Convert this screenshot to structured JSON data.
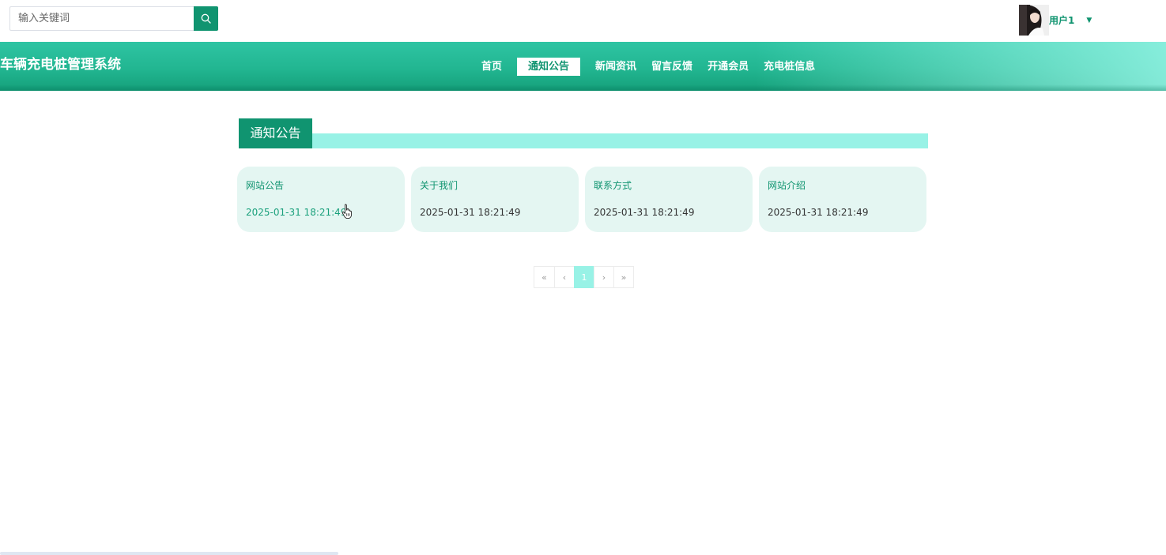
{
  "search": {
    "placeholder": "输入关键词"
  },
  "user": {
    "name": "用户1"
  },
  "header": {
    "title": "车辆充电桩管理系统",
    "nav": [
      {
        "label": "首页",
        "active": false
      },
      {
        "label": "通知公告",
        "active": true
      },
      {
        "label": "新闻资讯",
        "active": false
      },
      {
        "label": "留言反馈",
        "active": false
      },
      {
        "label": "开通会员",
        "active": false
      },
      {
        "label": "充电桩信息",
        "active": false
      }
    ]
  },
  "section": {
    "title": "通知公告"
  },
  "cards": [
    {
      "title": "网站公告",
      "time": "2025-01-31 18:21:49"
    },
    {
      "title": "关于我们",
      "time": "2025-01-31 18:21:49"
    },
    {
      "title": "联系方式",
      "time": "2025-01-31 18:21:49"
    },
    {
      "title": "网站介绍",
      "time": "2025-01-31 18:21:49"
    }
  ],
  "pagination": {
    "first": "«",
    "prev": "‹",
    "current": "1",
    "next": "›",
    "last": "»"
  },
  "colors": {
    "primary": "#109470",
    "header_gradient_start": "#2ec4a3",
    "accent_light": "#98f2e6",
    "card_bg": "#e4f6f2"
  },
  "icons": {
    "search": "search-icon",
    "dropdown": "caret-down-icon",
    "cursor": "pointer-hand-icon"
  }
}
